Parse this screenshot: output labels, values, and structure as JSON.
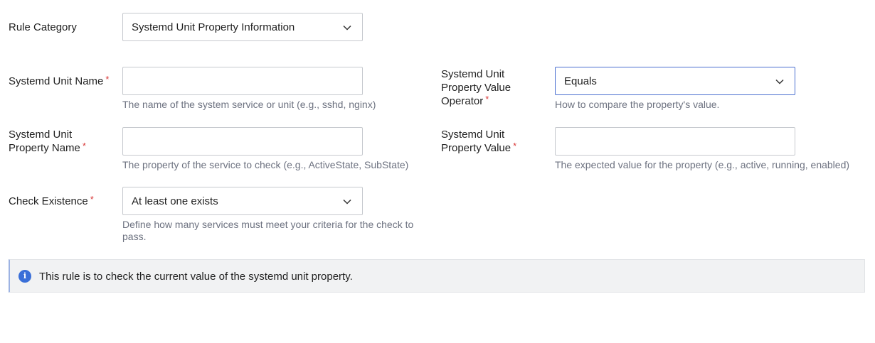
{
  "form": {
    "rule_category": {
      "label": "Rule Category",
      "value": "Systemd Unit Property Information"
    },
    "unit_name": {
      "label": "Systemd Unit Name",
      "required_mark": "*",
      "value": "",
      "help": "The name of the system service or unit (e.g., sshd, nginx)"
    },
    "property_name": {
      "label_line1": "Systemd Unit",
      "label_line2": "Property Name",
      "required_mark": "*",
      "value": "",
      "help": "The property of the service to check (e.g., ActiveState, SubState)"
    },
    "check_existence": {
      "label": "Check Existence",
      "required_mark": "*",
      "value": "At least one exists",
      "help_line1": "Define how many services must meet your criteria for the check to",
      "help_line2": "pass."
    },
    "value_operator": {
      "label_line1": "Systemd Unit",
      "label_line2": "Property Value",
      "label_line3": "Operator",
      "required_mark": "*",
      "value": "Equals",
      "help": "How to compare the property's value."
    },
    "property_value": {
      "label_line1": "Systemd Unit",
      "label_line2": "Property Value",
      "required_mark": "*",
      "value": "",
      "help": "The expected value for the property (e.g., active, running, enabled)"
    }
  },
  "banner": {
    "icon": "info-icon",
    "icon_glyph": "i",
    "message": "This rule is to check the current value of the systemd unit property."
  },
  "colors": {
    "required": "#d93b3b",
    "info_icon": "#3a6fd8",
    "focus_border": "#4a6fd0"
  }
}
